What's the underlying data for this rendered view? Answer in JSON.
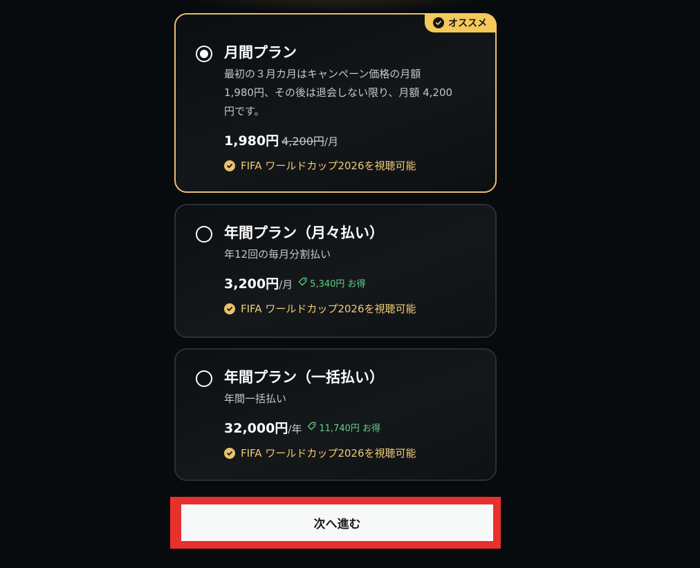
{
  "plans": [
    {
      "title": "月間プラン",
      "selected": true,
      "badge": "オススメ",
      "description": [
        "最初の３月カ月はキャンペーン価格の月額",
        "1,980円、その後は退会しない限り、月額 4,200",
        "円です。"
      ],
      "price": "1,980円",
      "old_price": "4,200円",
      "period": "/月",
      "feature": "FIFA ワールドカップ2026を視聴可能"
    },
    {
      "title": "年間プラン（月々払い）",
      "selected": false,
      "description": [
        "年12回の毎月分割払い"
      ],
      "price": "3,200円",
      "period": "/月",
      "savings": "5,340円 お得",
      "feature": "FIFA ワールドカップ2026を視聴可能"
    },
    {
      "title": "年間プラン（一括払い）",
      "selected": false,
      "description": [
        "年間一括払い"
      ],
      "price": "32,000円",
      "period": "/年",
      "savings": "11,740円 お得",
      "feature": "FIFA ワールドカップ2026を視聴可能"
    }
  ],
  "cta": {
    "label": "次へ進む"
  },
  "icons": {
    "badge": "verified-badge-icon",
    "feature": "check-circle-icon",
    "savings": "tag-icon"
  },
  "colors": {
    "background": "#080b0e",
    "accent_gold": "#e8c26a",
    "badge": "#f5c85a",
    "savings_green": "#5fd184",
    "highlight_red": "#e8302d"
  }
}
